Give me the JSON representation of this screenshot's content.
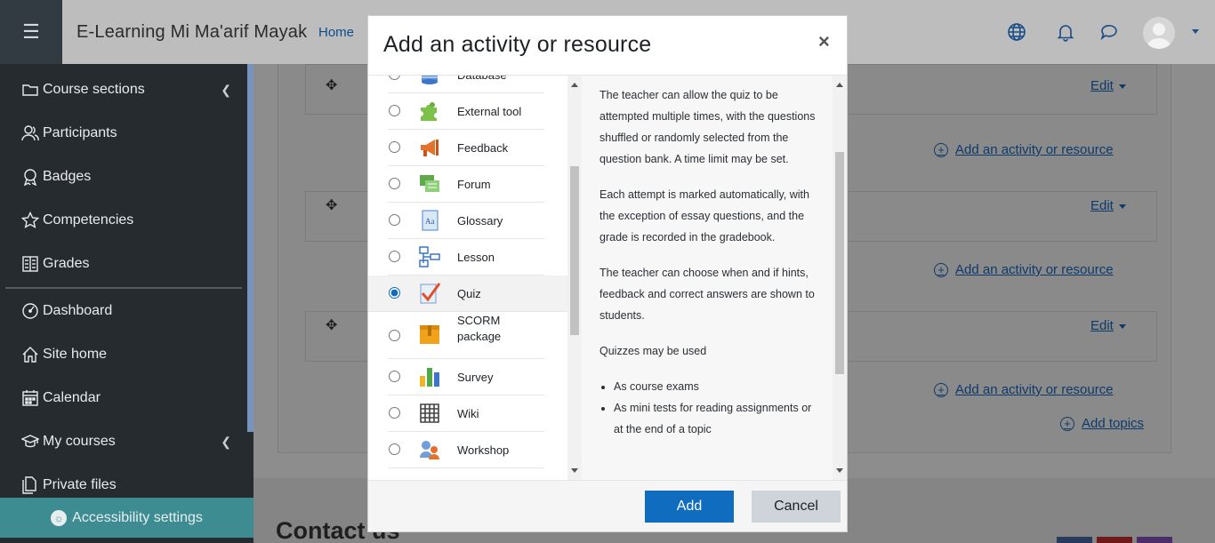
{
  "navbar": {
    "menu_icon": "hamburger-icon",
    "site_name": "E-Learning Mi Ma'arif Mayak",
    "home_link": "Home",
    "icons": [
      "globe-icon",
      "bell-icon",
      "chat-icon"
    ]
  },
  "sidebar": {
    "items": [
      {
        "label": "Course sections",
        "icon": "folder-icon"
      },
      {
        "label": "Participants",
        "icon": "users-icon"
      },
      {
        "label": "Badges",
        "icon": "badge-icon"
      },
      {
        "label": "Competencies",
        "icon": "star-icon"
      },
      {
        "label": "Grades",
        "icon": "grades-icon"
      },
      {
        "label": "Dashboard",
        "icon": "dashboard-icon"
      },
      {
        "label": "Site home",
        "icon": "home-icon"
      },
      {
        "label": "Calendar",
        "icon": "calendar-icon"
      },
      {
        "label": "My courses",
        "icon": "graduation-cap-icon"
      },
      {
        "label": "Private files",
        "icon": "files-icon"
      }
    ],
    "accessibility_label": "Accessibility settings"
  },
  "course": {
    "edit_label": "Edit",
    "add_activity_label": "Add an activity or resource",
    "add_topics_label": "Add topics",
    "footer_title": "Contact us"
  },
  "modal": {
    "title": "Add an activity or resource",
    "close": "×",
    "options": [
      {
        "label": "Database",
        "icon": "database-icon"
      },
      {
        "label": "External tool",
        "icon": "puzzle-icon"
      },
      {
        "label": "Feedback",
        "icon": "megaphone-icon"
      },
      {
        "label": "Forum",
        "icon": "forum-icon"
      },
      {
        "label": "Glossary",
        "icon": "glossary-icon"
      },
      {
        "label": "Lesson",
        "icon": "lesson-icon"
      },
      {
        "label": "Quiz",
        "icon": "quiz-icon",
        "selected": true
      },
      {
        "label": "SCORM package",
        "icon": "scorm-icon"
      },
      {
        "label": "Survey",
        "icon": "survey-icon"
      },
      {
        "label": "Wiki",
        "icon": "wiki-icon"
      },
      {
        "label": "Workshop",
        "icon": "workshop-icon"
      }
    ],
    "description": {
      "p1": "The teacher can allow the quiz to be attempted multiple times, with the questions shuffled or randomly selected from the question bank. A time limit may be set.",
      "p2": "Each attempt is marked automatically, with the exception of essay questions, and the grade is recorded in the gradebook.",
      "p3": "The teacher can choose when and if hints, feedback and correct answers are shown to students.",
      "p4": "Quizzes may be used",
      "bullets": [
        "As course exams",
        "As mini tests for reading assignments or at the end of a topic"
      ]
    },
    "add_button": "Add",
    "cancel_button": "Cancel"
  },
  "colors": {
    "primary": "#0f6cbf",
    "sidebar_bg": "#262b30",
    "accessibility_bg": "#3c8c92"
  }
}
